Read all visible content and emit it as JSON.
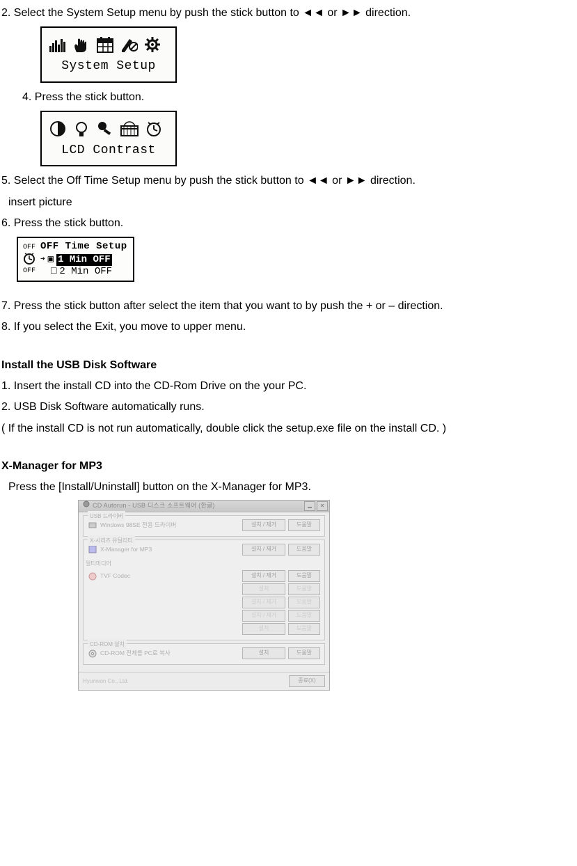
{
  "steps": {
    "s2": "2. Select the System Setup menu by push the stick button to  ◄◄  or  ►►  direction.",
    "s4": "4.    Press the stick button.",
    "s5": "5. Select the Off Time Setup menu by push the stick button to  ◄◄  or  ►►  direction.",
    "s5a": "insert picture",
    "s6": "6. Press the stick button.",
    "s7": "7. Press the stick button after select the item that you want to by push the + or – direction.",
    "s8": "8. If you select the Exit, you move to upper menu."
  },
  "lcd1": {
    "label": "System Setup"
  },
  "lcd2": {
    "label": "LCD Contrast"
  },
  "offpanel": {
    "sideTop": "OFF",
    "sideBottom": "OFF",
    "title": "OFF Time Setup",
    "opt1": "1 Min OFF",
    "opt2": "2 Min OFF"
  },
  "h_install": "Install the USB Disk Software",
  "install": {
    "i1": "1. Insert the install CD into the CD-Rom Drive on the your PC.",
    "i2": "2. USB Disk Software automatically runs.",
    "i3": "( If the install CD is not run automatically, double click the setup.exe file on the install CD. )"
  },
  "h_xm": "X-Manager for MP3",
  "xm_text": "Press the [Install/Uninstall] button on the X-Manager for MP3.",
  "installer": {
    "title": "CD Autorun - USB 디스크 소프트웨어 (한글)",
    "group1": {
      "label": "USB 드라이버",
      "item": "Windows 98SE 전용 드라이버",
      "btn1": "설치 / 제거",
      "btn2": "도움말"
    },
    "group2": {
      "label": "X-시리즈 유틸리티",
      "r1": {
        "item": "X-Manager for MP3",
        "btn1": "설치 / 제거",
        "btn2": "도움말"
      },
      "r2_label": "멀티미디어",
      "r2": {
        "item": "TVF Codec",
        "btn1": "설치 / 제거",
        "btn2": "도움말"
      },
      "r3": {
        "btn1": "설치",
        "btn2": "도움말"
      },
      "r4": {
        "btn1": "설치 / 제거",
        "btn2": "도움말"
      },
      "r5": {
        "btn1": "설치 / 제거",
        "btn2": "도움말"
      },
      "r6": {
        "btn1": "설치",
        "btn2": "도움말"
      }
    },
    "group3": {
      "label": "CD-ROM 설치",
      "item": "CD-ROM 전체를 PC로 복사",
      "btn1": "설치",
      "btn2": "도움말"
    },
    "company": "Hyunwon Co., Ltd.",
    "closeBtn": "종료(X)"
  }
}
